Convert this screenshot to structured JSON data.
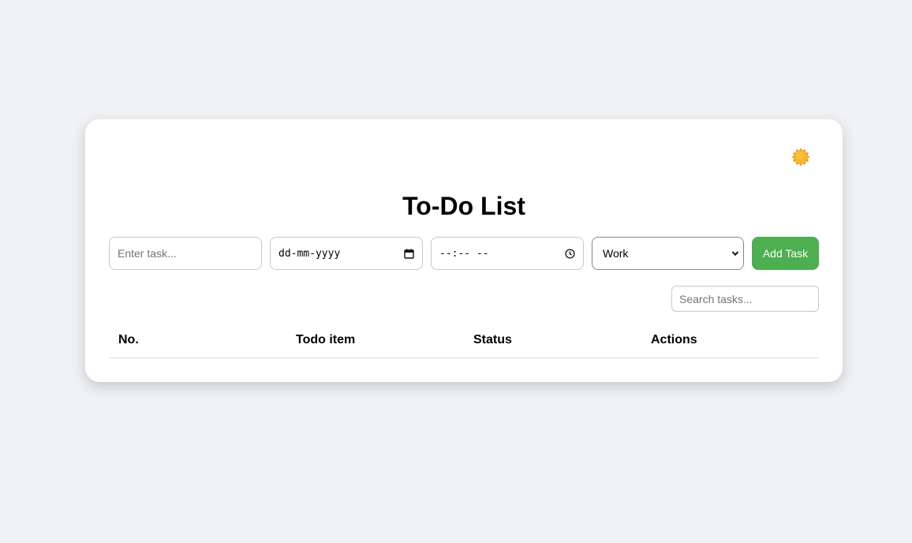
{
  "app": {
    "title": "To-Do List",
    "theme_toggle_icon": "sun-icon"
  },
  "form": {
    "task_placeholder": "Enter task...",
    "date_placeholder": "dd-mm-yyyy",
    "date_icon": "calendar-icon",
    "time_placeholder": "--:-- --",
    "time_icon": "clock-icon",
    "category_selected": "Work",
    "category_icon": "chevron-down-icon",
    "add_button_label": "Add Task"
  },
  "search": {
    "placeholder": "Search tasks..."
  },
  "table": {
    "columns": [
      "No.",
      "Todo item",
      "Status",
      "Actions"
    ],
    "rows": []
  },
  "colors": {
    "accent": "#4caf50",
    "background": "#f0f2f5",
    "card": "#ffffff",
    "sun": "#f4b400"
  }
}
